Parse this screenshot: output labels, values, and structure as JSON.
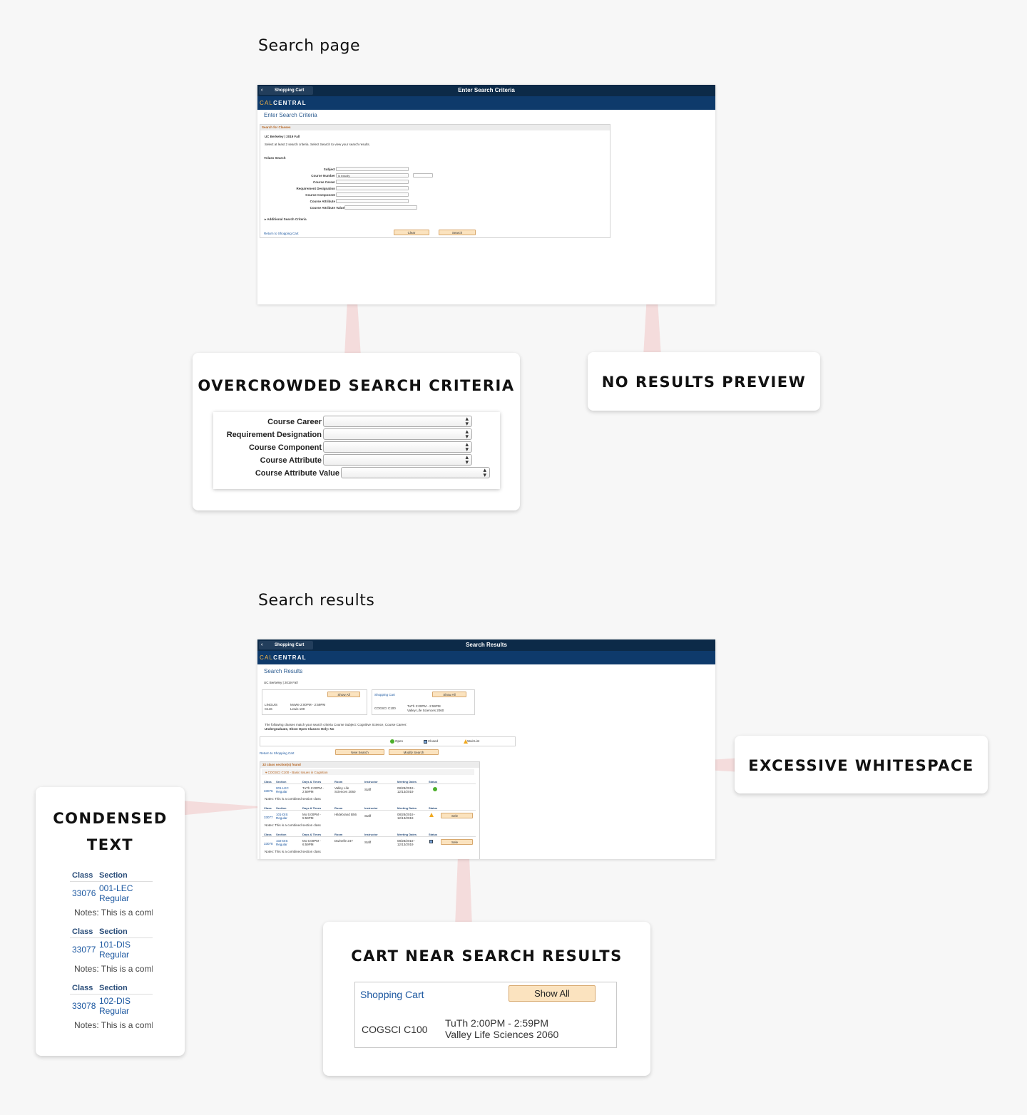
{
  "sections": {
    "search_page_title": "Search page",
    "search_results_title": "Search results"
  },
  "search_shot": {
    "cart_button": "Shopping Cart",
    "header_title": "Enter Search Criteria",
    "brand_cal": "CAL",
    "brand_central": "CENTRAL",
    "breadcrumb": "Enter Search Criteria",
    "panel_title": "Search for Classes",
    "term": "UC Berkeley | 2019 Fall",
    "instructions": "Select at least 2 search criteria. Select Search to view your search results.",
    "class_search_toggle": "Class Search",
    "fields": [
      {
        "label": "Subject",
        "value": ""
      },
      {
        "label": "Course Number",
        "value": "is exactly"
      },
      {
        "label": "Course Career",
        "value": ""
      },
      {
        "label": "Requirement Designation",
        "value": ""
      },
      {
        "label": "Course Component",
        "value": ""
      },
      {
        "label": "Course Attribute",
        "value": ""
      },
      {
        "label": "Course Attribute Value",
        "value": ""
      }
    ],
    "additional_criteria": "Additional Search Criteria",
    "return_link": "Return to Shopping Cart",
    "clear_button": "Clear",
    "search_button": "Search"
  },
  "callout_overcrowded": {
    "title": "OVERCROWDED SEARCH CRITERIA",
    "rows": [
      "Course Career",
      "Requirement Designation",
      "Course Component",
      "Course Attribute",
      "Course Attribute Value"
    ]
  },
  "callout_no_results": {
    "title": "NO RESULTS PREVIEW"
  },
  "results_shot": {
    "cart_button": "Shopping Cart",
    "header_title": "Search Results",
    "brand_cal": "CAL",
    "brand_central": "CENTRAL",
    "breadcrumb": "Search Results",
    "term": "UC Berkeley | 2019 Fall",
    "show_all_1": "Show All",
    "enrolled_course": "LINGUIS C146",
    "enrolled_course_a": "LINGUIS",
    "enrolled_course_b": "C146",
    "enrolled_time": "MoWe 2:00PM - 2:59PM",
    "enrolled_room": "Lewis 100",
    "cart_title": "Shopping Cart",
    "show_all_2": "Show All",
    "cart_course": "COGSCI C100",
    "cart_time": "TuTh 2:00PM - 2:59PM",
    "cart_room": "Valley Life Sciences 2060",
    "criteria_line1": "The following classes match your search criteria Course Subject: Cognitive Science, Course Career:",
    "criteria_line2": "Undergraduate, Show Open Classes Only: No",
    "legend_open": "Open",
    "legend_closed": "Closed",
    "legend_wait": "Wait List",
    "return_link": "Return to Shopping Cart",
    "new_search": "New Search",
    "modify_search": "Modify Search",
    "found": "32 class section(s) found",
    "course_header": "COGSCI C100 - Basic Issues in Cognition",
    "col_headers": [
      "Class",
      "Section",
      "Days & Times",
      "Room",
      "Instructor",
      "Meeting Dates",
      "Status"
    ],
    "rows": [
      {
        "class": "33076",
        "section": "001-LEC",
        "section2": "Regular",
        "days": "TuTh 2:00PM -",
        "days2": "2:59PM",
        "room": "Valley Life",
        "room2": "Sciences 2060",
        "instructor": "Staff",
        "dates": "08/28/2019 -",
        "dates2": "12/13/2019",
        "note": "Notes: This is a combined section class",
        "status": "open"
      },
      {
        "class": "33077",
        "section": "101-DIS",
        "section2": "Regular",
        "days": "Mo 5:00PM -",
        "days2": "5:59PM",
        "room": "Hildebrand B56",
        "room2": "",
        "instructor": "Staff",
        "dates": "08/28/2019 -",
        "dates2": "12/13/2019",
        "note": "Notes: This is a combined section class",
        "status": "wait"
      },
      {
        "class": "33078",
        "section": "102-DIS",
        "section2": "Regular",
        "days": "Mo 6:00PM -",
        "days2": "6:59PM",
        "room": "Dwinelle 247",
        "room2": "",
        "instructor": "Staff",
        "dates": "08/28/2019 -",
        "dates2": "12/13/2019",
        "note": "Notes: This is a combined section class",
        "status": "closed"
      }
    ],
    "select_label": "Sele"
  },
  "callout_whitespace": {
    "title": "EXCESSIVE WHITESPACE"
  },
  "callout_condensed": {
    "title_line1": "CONDENSED",
    "title_line2": "TEXT",
    "class_header": "Class",
    "section_header": "Section",
    "groups": [
      {
        "class": "33076",
        "section": "001-LEC",
        "type": "Regular",
        "note": "Notes: This is a comb"
      },
      {
        "class": "33077",
        "section": "101-DIS",
        "type": "Regular",
        "note": "Notes: This is a comb"
      },
      {
        "class": "33078",
        "section": "102-DIS",
        "type": "Regular",
        "note": "Notes: This is a comb"
      }
    ]
  },
  "callout_cart": {
    "title": "CART NEAR SEARCH RESULTS",
    "cart_title": "Shopping Cart",
    "show_all": "Show All",
    "course": "COGSCI C100",
    "time": "TuTh 2:00PM - 2:59PM",
    "room": "Valley Life Sciences 2060"
  },
  "colors": {
    "nav_dark": "#0c2a48",
    "brand_blue": "#0e3a6b",
    "brand_gold": "#f6b547",
    "pointer_pink": "#f4dcdc",
    "button_peach": "#fbe3bf"
  }
}
